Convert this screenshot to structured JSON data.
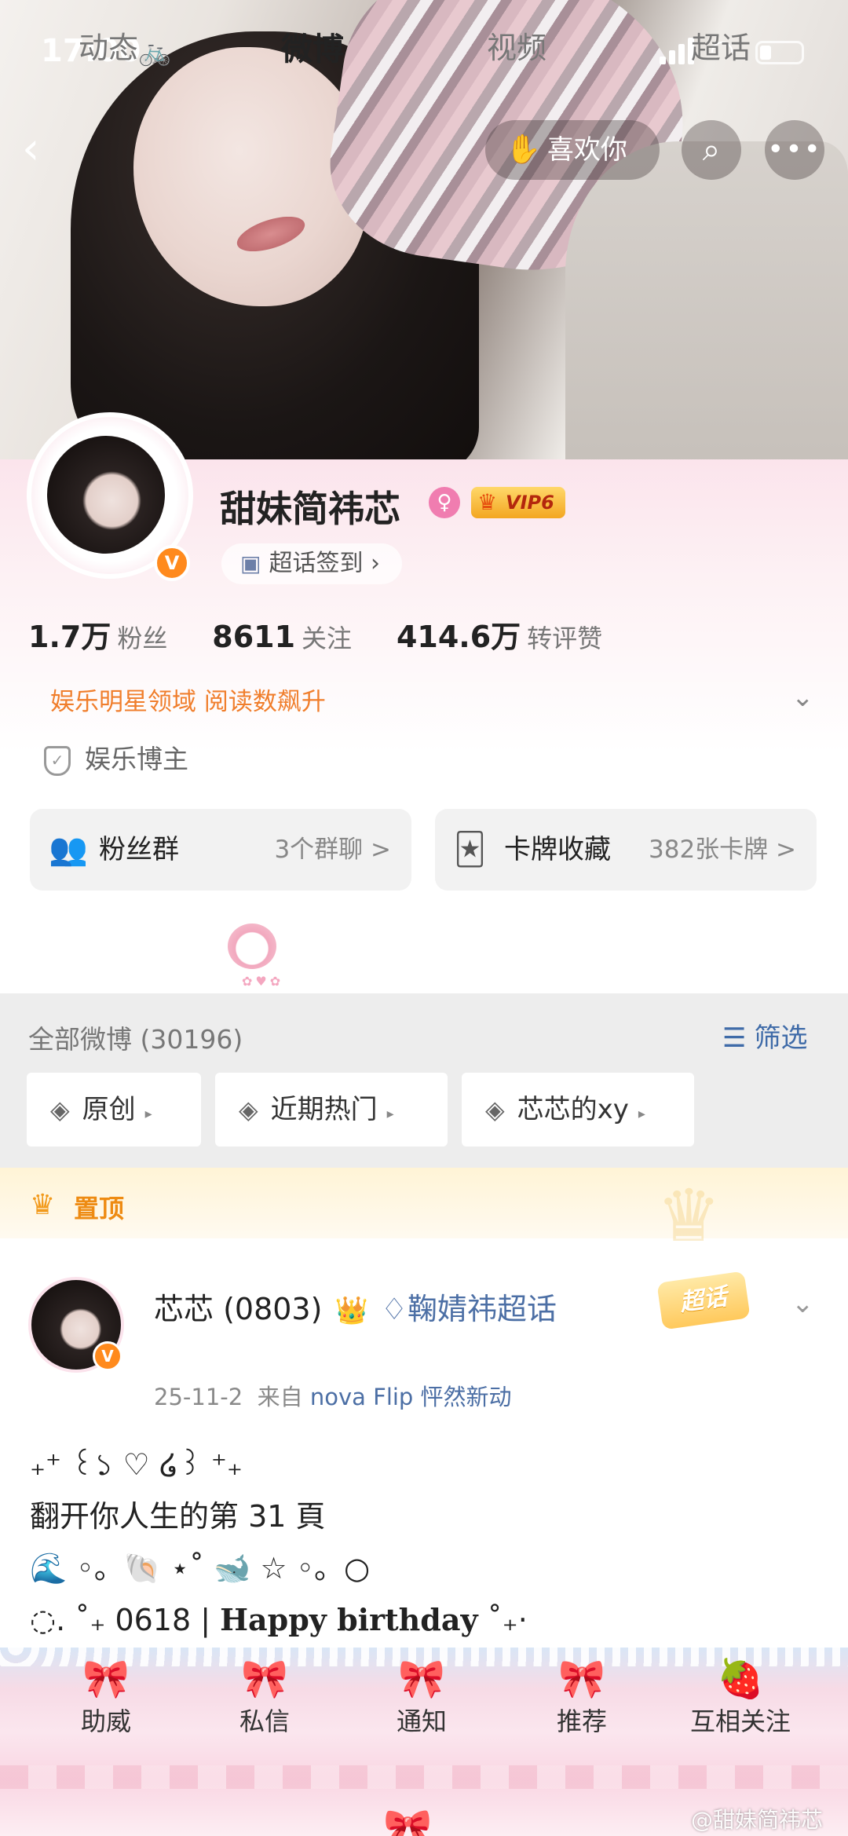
{
  "status_bar": {
    "time": "17:00"
  },
  "header": {
    "like_label": "喜欢你"
  },
  "profile": {
    "name": "甜妹简祎芯",
    "vip": "VIP6",
    "verified_badge": "V",
    "supertopic_sign": "超话签到",
    "stats": [
      {
        "num": "1.7万",
        "label": "粉丝"
      },
      {
        "num": "8611",
        "label": "关注"
      },
      {
        "num": "414.6万",
        "label": "转评赞"
      }
    ],
    "honor": "娱乐明星领域 阅读数飙升",
    "tag": "娱乐博主"
  },
  "cards": [
    {
      "title": "粉丝群",
      "sub": "3个群聊 >"
    },
    {
      "title": "卡牌收藏",
      "sub": "382张卡牌 >"
    }
  ],
  "tabs": [
    "动态",
    "微博",
    "视频",
    "超话"
  ],
  "filters": {
    "all_label": "全部微博 (30196)",
    "filter_label": "筛选",
    "chips": [
      "原创",
      "近期热门",
      "芯芯的xy"
    ]
  },
  "pinned": {
    "label": "置顶",
    "author": "芯芯 (0803)",
    "topic_link": "鞠婧祎超话",
    "date": "25-11-2",
    "from_label": "来自",
    "source": "nova Flip 怦然新动",
    "badge": "超话",
    "body": [
      "₊⁺ ꒰১ ♡ ໒꒱ ⁺₊",
      "翻开你人生的第 31 頁",
      "🌊 ◦。🐚 ⋆˚ 🐋 ☆ ◦。○",
      "◌. ˚₊ 0618 | ",
      "Happy birthday",
      " ˚₊·"
    ]
  },
  "bottom_nav": [
    "助威",
    "私信",
    "通知",
    "推荐",
    "互相关注"
  ],
  "watermark": "@甜妹简祎芯",
  "colors": {
    "accent_orange": "#f07e2c",
    "link_blue": "#4c6fa5",
    "pin_orange": "#ee8b12",
    "pink": "#f07db0"
  }
}
